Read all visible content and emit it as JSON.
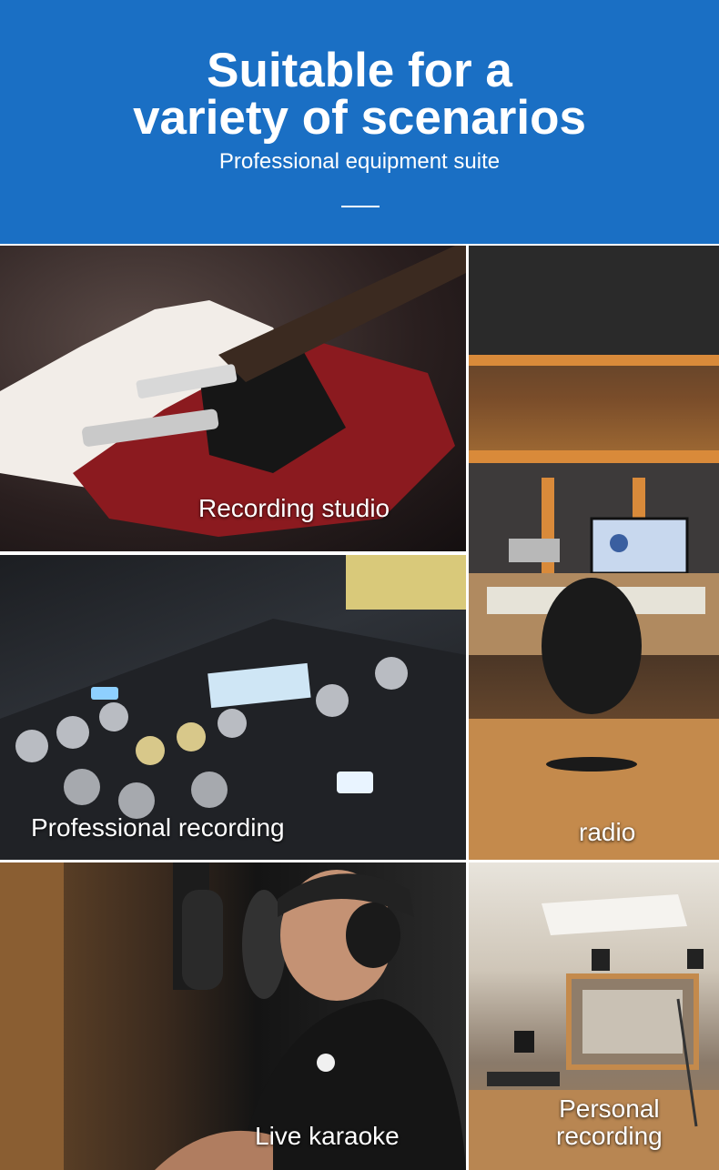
{
  "header": {
    "title_line1": "Suitable for a",
    "title_line2": "variety of scenarios",
    "subtitle": "Professional equipment suite",
    "background_color": "#1a6fc4"
  },
  "scenarios": [
    {
      "label": "Recording studio"
    },
    {
      "label": "radio"
    },
    {
      "label": "Professional recording"
    },
    {
      "label": "Live karaoke"
    },
    {
      "label_line1": "Personal",
      "label_line2": "recording"
    }
  ]
}
